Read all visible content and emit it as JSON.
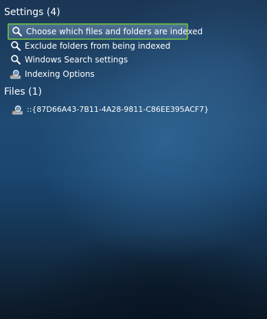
{
  "settings": {
    "header": "Settings (4)",
    "items": [
      {
        "label": "Choose which files and folders are indexed",
        "icon": "search-icon"
      },
      {
        "label": "Exclude folders from being indexed",
        "icon": "search-icon"
      },
      {
        "label": "Windows Search settings",
        "icon": "search-icon"
      },
      {
        "label": "Indexing Options",
        "icon": "indexing-options-icon"
      }
    ]
  },
  "files": {
    "header": "Files (1)",
    "items": [
      {
        "label": "::{87D66A43-7B11-4A28-9811-C86EE395ACF7}",
        "icon": "indexing-options-icon"
      }
    ]
  },
  "colors": {
    "selection_border": "#63b44b",
    "text": "#ffffff"
  }
}
